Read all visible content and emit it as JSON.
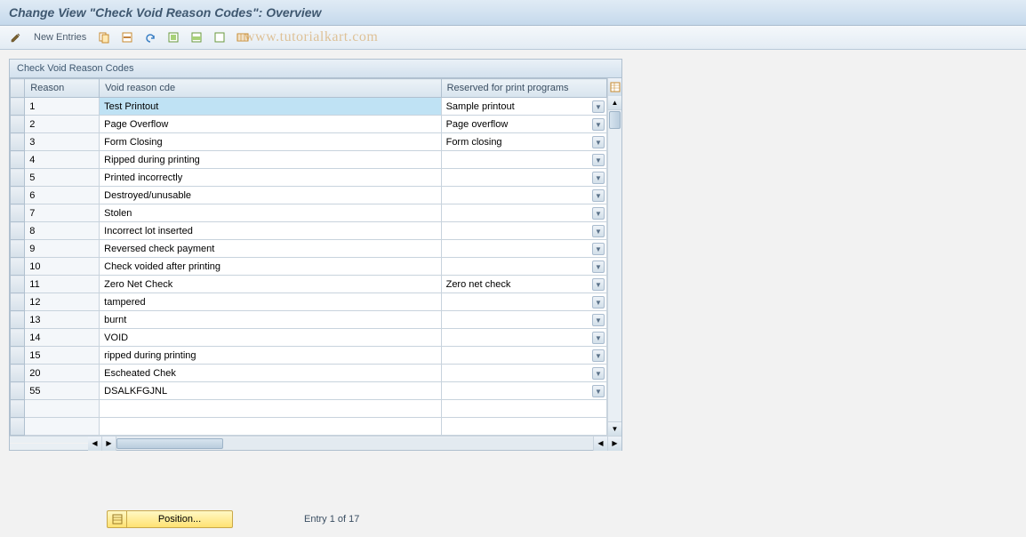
{
  "title": "Change View \"Check Void Reason Codes\": Overview",
  "toolbar": {
    "new_entries": "New Entries"
  },
  "watermark": "www.tutorialkart.com",
  "grid": {
    "title": "Check Void Reason Codes",
    "columns": {
      "reason": "Reason",
      "void_cde": "Void reason cde",
      "reserved": "Reserved for print programs"
    },
    "rows": [
      {
        "reason": "1",
        "void": "Test Printout",
        "reserved": "Sample printout",
        "selected": true
      },
      {
        "reason": "2",
        "void": "Page Overflow",
        "reserved": "Page overflow"
      },
      {
        "reason": "3",
        "void": "Form Closing",
        "reserved": "Form closing"
      },
      {
        "reason": "4",
        "void": "Ripped during printing",
        "reserved": ""
      },
      {
        "reason": "5",
        "void": "Printed incorrectly",
        "reserved": ""
      },
      {
        "reason": "6",
        "void": "Destroyed/unusable",
        "reserved": ""
      },
      {
        "reason": "7",
        "void": "Stolen",
        "reserved": ""
      },
      {
        "reason": "8",
        "void": "Incorrect lot inserted",
        "reserved": ""
      },
      {
        "reason": "9",
        "void": "Reversed check payment",
        "reserved": ""
      },
      {
        "reason": "10",
        "void": "Check voided after printing",
        "reserved": ""
      },
      {
        "reason": "11",
        "void": "Zero Net Check",
        "reserved": "Zero net check"
      },
      {
        "reason": "12",
        "void": "tampered",
        "reserved": ""
      },
      {
        "reason": "13",
        "void": "burnt",
        "reserved": ""
      },
      {
        "reason": "14",
        "void": "VOID",
        "reserved": ""
      },
      {
        "reason": "15",
        "void": "ripped during printing",
        "reserved": ""
      },
      {
        "reason": "20",
        "void": "Escheated Chek",
        "reserved": ""
      },
      {
        "reason": "55",
        "void": "DSALKFGJNL",
        "reserved": ""
      },
      {
        "reason": "",
        "void": "",
        "reserved": "",
        "empty": true
      },
      {
        "reason": "",
        "void": "",
        "reserved": "",
        "empty": true
      }
    ]
  },
  "footer": {
    "position_label": "Position...",
    "entry_status": "Entry 1 of 17"
  }
}
